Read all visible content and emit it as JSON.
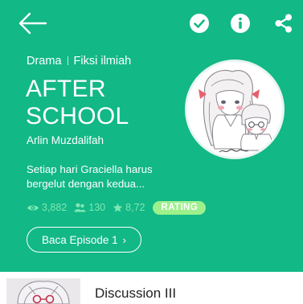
{
  "colors": {
    "accent": "#12b886",
    "stat": "#7ee8b4",
    "badge": "#9df08c"
  },
  "toolbar": {
    "back_icon": "arrow-left-icon",
    "subscribe_icon": "check-circle-icon",
    "info_icon": "info-icon",
    "share_icon": "share-icon"
  },
  "series": {
    "genres": [
      "Drama",
      "Fiksi ilmiah"
    ],
    "title_line1": "AFTER",
    "title_line2": "SCHOOL",
    "author": "Arlin Muzdalifah",
    "synopsis_line1": "Setiap hari Graciella harus",
    "synopsis_line2": "bergelut dengan kedua..."
  },
  "stats": {
    "views": "3,882",
    "likes": "130",
    "rating": "8,72",
    "rating_badge": "RATING"
  },
  "actions": {
    "read_label": "Baca Episode 1",
    "read_chevron": "›"
  },
  "episode": {
    "title": "Discussion III"
  }
}
